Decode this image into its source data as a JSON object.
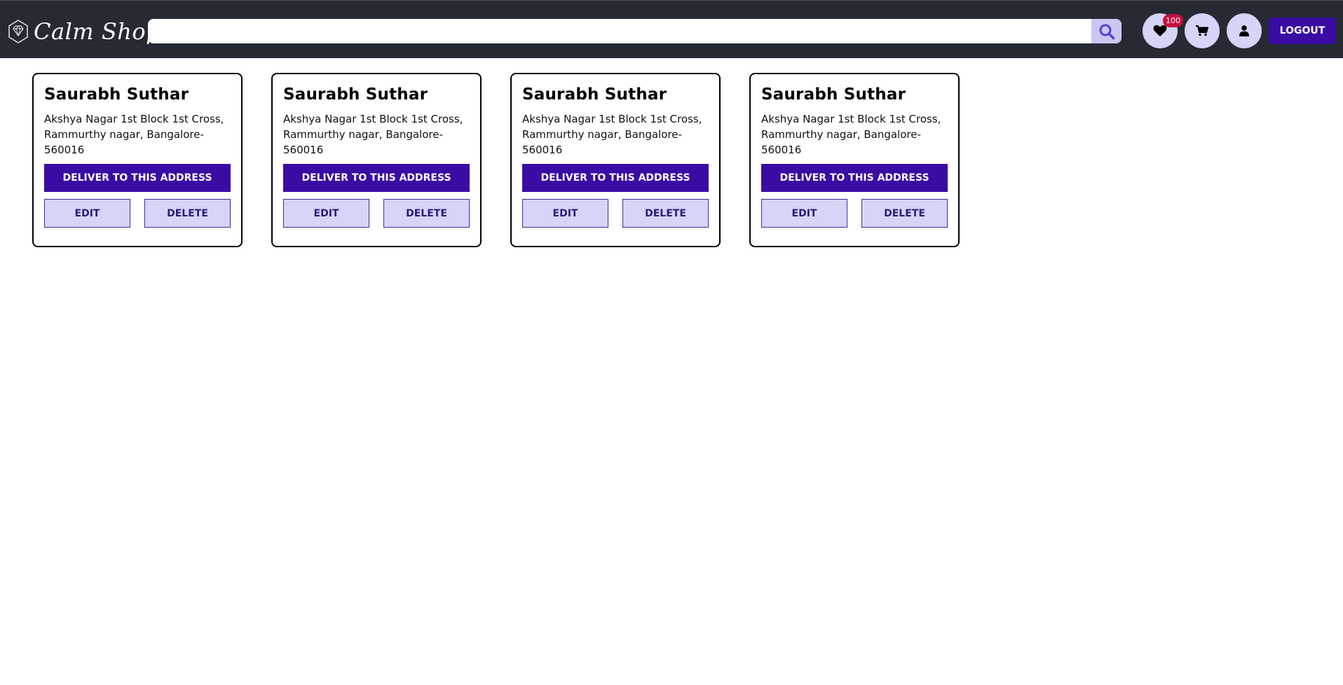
{
  "header": {
    "brand_name": "Calm Shop",
    "brand_icon": "diamond-icon",
    "search": {
      "value": "",
      "placeholder": "",
      "button_icon": "search-icon"
    },
    "wishlist": {
      "icon": "heart-icon",
      "badge": "100"
    },
    "cart": {
      "icon": "cart-icon"
    },
    "profile": {
      "icon": "user-icon"
    },
    "logout_label": "LOGOUT"
  },
  "colors": {
    "navbar_bg": "#252a33",
    "primary": "#3a0ca3",
    "secondary_bg": "#d6d4f7",
    "badge": "#c40f3f"
  },
  "addresses": [
    {
      "name": "Saurabh Suthar",
      "address": "Akshya Nagar 1st Block 1st Cross, Rammurthy nagar, Bangalore-560016",
      "deliver_label": "DELIVER TO THIS ADDRESS",
      "edit_label": "EDIT",
      "delete_label": "DELETE"
    },
    {
      "name": "Saurabh Suthar",
      "address": "Akshya Nagar 1st Block 1st Cross, Rammurthy nagar, Bangalore-560016",
      "deliver_label": "DELIVER TO THIS ADDRESS",
      "edit_label": "EDIT",
      "delete_label": "DELETE"
    },
    {
      "name": "Saurabh Suthar",
      "address": "Akshya Nagar 1st Block 1st Cross, Rammurthy nagar, Bangalore-560016",
      "deliver_label": "DELIVER TO THIS ADDRESS",
      "edit_label": "EDIT",
      "delete_label": "DELETE"
    },
    {
      "name": "Saurabh Suthar",
      "address": "Akshya Nagar 1st Block 1st Cross, Rammurthy nagar, Bangalore-560016",
      "deliver_label": "DELIVER TO THIS ADDRESS",
      "edit_label": "EDIT",
      "delete_label": "DELETE"
    }
  ]
}
